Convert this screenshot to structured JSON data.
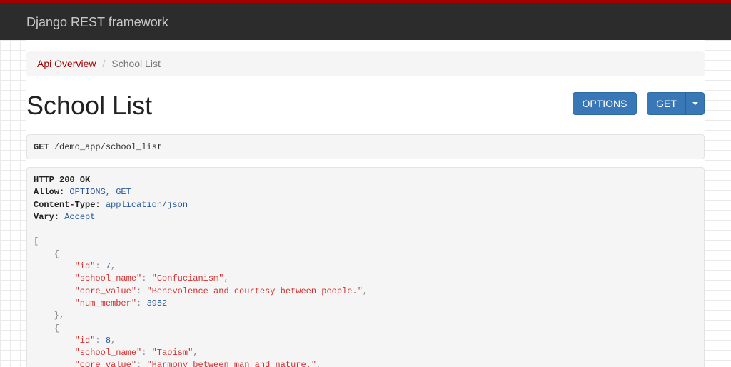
{
  "navbar": {
    "brand": "Django REST framework"
  },
  "breadcrumb": {
    "items": [
      {
        "label": "Api Overview",
        "active": false
      },
      {
        "label": "School List",
        "active": true
      }
    ],
    "separator": "/"
  },
  "page": {
    "title": "School List"
  },
  "buttons": {
    "options": "OPTIONS",
    "get": "GET"
  },
  "request": {
    "method": "GET",
    "path": "/demo_app/school_list"
  },
  "response": {
    "status_line": "HTTP 200 OK",
    "headers": [
      {
        "name": "Allow:",
        "value": "OPTIONS, GET"
      },
      {
        "name": "Content-Type:",
        "value": "application/json"
      },
      {
        "name": "Vary:",
        "value": "Accept"
      }
    ],
    "body": [
      {
        "id": "7",
        "school_name": "Confucianism",
        "core_value": "Benevolence and courtesy between people.",
        "num_member": "3952"
      },
      {
        "id": "8",
        "school_name": "Taoism",
        "core_value": "Harmony between man and nature."
      }
    ]
  },
  "colors": {
    "accent": "#a30000",
    "navbar": "#2c2c2c",
    "button": "#3a77b7"
  }
}
